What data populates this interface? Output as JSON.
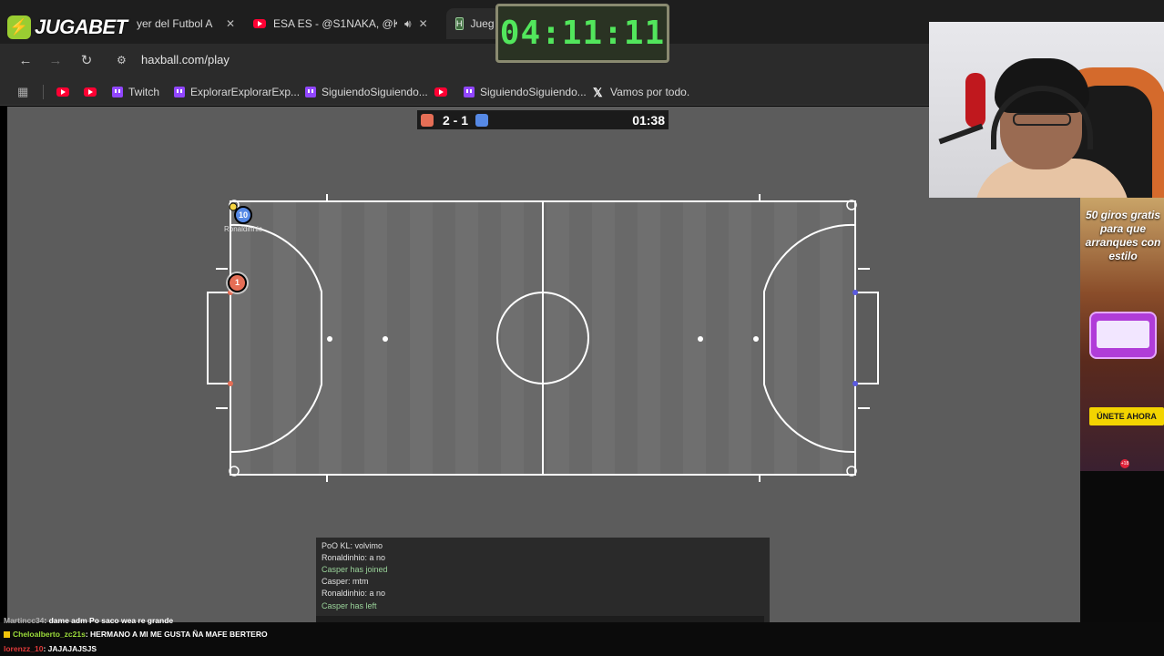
{
  "overlay": {
    "brand_logo": "JUGABET",
    "big_timer": "04:11:11"
  },
  "browser": {
    "tabs": [
      {
        "label": "yer del Futbol A",
        "icon": "jugabet-icon"
      },
      {
        "label": "ESA ES - @S1NAKA, @Kenn",
        "icon": "youtube-icon",
        "audio": true
      },
      {
        "label": "Jueg",
        "icon": "haxball-icon",
        "active": true
      }
    ],
    "url": "haxball.com/play",
    "bookmarks": [
      {
        "label": "",
        "icon": "youtube-icon"
      },
      {
        "label": "",
        "icon": "youtube-icon"
      },
      {
        "label": "Twitch",
        "icon": "twitch-icon"
      },
      {
        "label": "ExplorarExplorarExp...",
        "icon": "twitch-icon"
      },
      {
        "label": "SiguiendoSiguiendo...",
        "icon": "twitch-icon"
      },
      {
        "label": "",
        "icon": "youtube-icon"
      },
      {
        "label": "SiguiendoSiguiendo...",
        "icon": "twitch-icon"
      },
      {
        "label": "Vamos por todo.",
        "icon": "x-icon"
      }
    ]
  },
  "game": {
    "score": "2 - 1",
    "time": "01:38",
    "colors": {
      "red": "#e56e56",
      "blue": "#5689e5"
    },
    "players": [
      {
        "number": "10",
        "name": "Ronaldinhio",
        "team": "blue"
      },
      {
        "number": "1",
        "name": "",
        "team": "red"
      }
    ],
    "chat": [
      {
        "text": "PoO KL: volvimo",
        "system": false
      },
      {
        "text": "Ronaldinhio: a no",
        "system": false
      },
      {
        "text": "Casper has joined",
        "system": true
      },
      {
        "text": "Casper: mtm",
        "system": false
      },
      {
        "text": "Ronaldinhio: a no",
        "system": false
      },
      {
        "text": "Casper has left",
        "system": true
      }
    ]
  },
  "ad": {
    "headline": "50 giros gratis para que arranques con estilo",
    "cta": "ÚNETE AHORA",
    "age": "+18"
  },
  "stream_chat": [
    {
      "user": "Martincc34",
      "message": ": dame adm Po saco wea re grande"
    },
    {
      "user": "Cheloalberto_zc21s",
      "message": ": HERMANO A MI ME GUSTA ÑA MAFE BERTERO"
    },
    {
      "user": "lorenzz_10",
      "message": ": JAJAJAJSJS"
    }
  ]
}
